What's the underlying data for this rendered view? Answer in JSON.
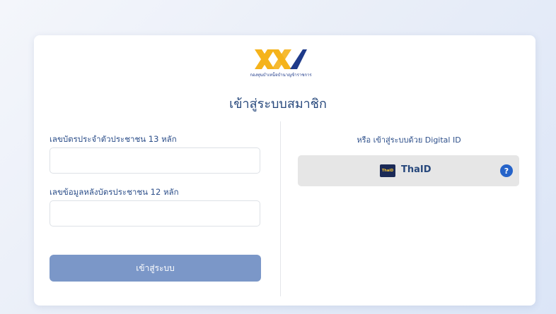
{
  "brand": {
    "logo_caption": "กองทุนบำเหน็จบำนาญข้าราชการ"
  },
  "login": {
    "title": "เข้าสู่ระบบสมาชิก",
    "id_card_label": "เลขบัตรประจำตัวประชาชน 13 หลัก",
    "id_card_value": "",
    "laser_code_label": "เลขข้อมูลหลังบัตรประชาชน 12 หลัก",
    "laser_code_value": "",
    "submit_label": "เข้าสู่ระบบ"
  },
  "digital_id": {
    "heading": "หรือ เข้าสู่ระบบด้วย Digital ID",
    "thaid_logo_text": "ThaiD",
    "thaid_label": "ThaID",
    "help_symbol": "?"
  },
  "colors": {
    "accent": "#27487c",
    "button": "#7b97c8",
    "logo_gold": "#f5b31b",
    "help": "#2563c9"
  }
}
